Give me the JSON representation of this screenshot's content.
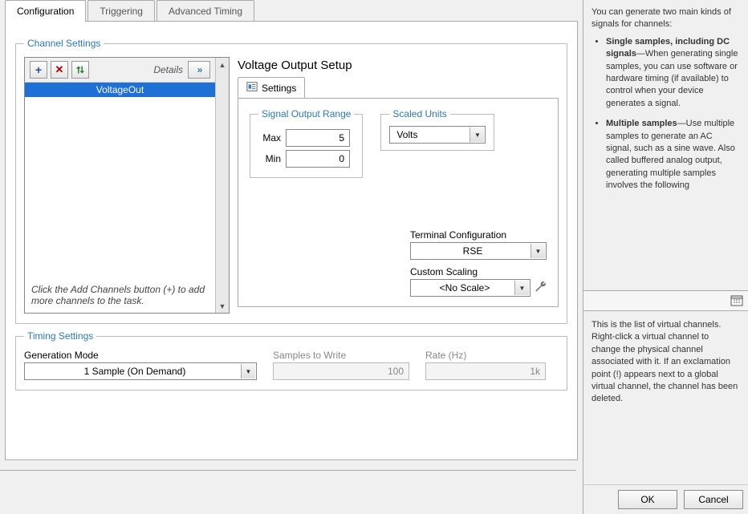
{
  "tabs": {
    "configuration": "Configuration",
    "triggering": "Triggering",
    "advanced_timing": "Advanced Timing"
  },
  "channel_settings": {
    "legend": "Channel Settings",
    "details_label": "Details",
    "items": [
      "VoltageOut"
    ],
    "hint": "Click the Add Channels button (+) to add more channels to the task."
  },
  "setup": {
    "title": "Voltage Output Setup",
    "settings_tab": "Settings",
    "range": {
      "legend": "Signal Output Range",
      "max_label": "Max",
      "max_value": "5",
      "min_label": "Min",
      "min_value": "0"
    },
    "scaled_units": {
      "legend": "Scaled Units",
      "value": "Volts"
    },
    "terminal_config": {
      "label": "Terminal Configuration",
      "value": "RSE"
    },
    "custom_scaling": {
      "label": "Custom Scaling",
      "value": "<No Scale>"
    }
  },
  "timing": {
    "legend": "Timing Settings",
    "gen_mode_label": "Generation Mode",
    "gen_mode_value": "1 Sample (On Demand)",
    "samples_label": "Samples to Write",
    "samples_value": "100",
    "rate_label": "Rate (Hz)",
    "rate_value": "1k"
  },
  "help": {
    "intro": "You can generate two main kinds of signals for channels:",
    "b1_title": "Single samples, including DC signals",
    "b1_body": "—When generating single samples, you can use software or hardware timing (if available) to control when your device generates a signal.",
    "b2_title": "Multiple samples",
    "b2_body": "—Use multiple samples to generate an AC signal, such as a sine wave. Also called buffered analog output, generating multiple samples involves the following",
    "context": "This is the list of virtual channels. Right-click a virtual channel to change the physical channel associated with it. If an exclamation point (!) appears next to a global virtual channel, the channel has been deleted."
  },
  "buttons": {
    "ok": "OK",
    "cancel": "Cancel"
  }
}
